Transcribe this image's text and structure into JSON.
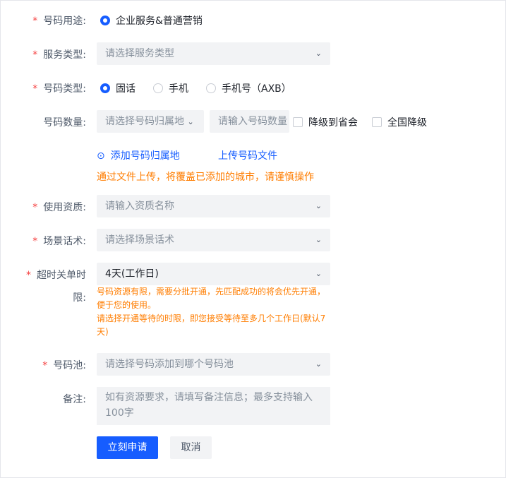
{
  "purpose": {
    "label": "号码用途:",
    "option": "企业服务&普通营销"
  },
  "service_type": {
    "label": "服务类型:",
    "placeholder": "请选择服务类型"
  },
  "number_type": {
    "label": "号码类型:",
    "options": [
      "固话",
      "手机",
      "手机号（AXB）"
    ],
    "selected": 0
  },
  "quantity": {
    "label": "号码数量:",
    "region_placeholder": "请选择号码归属地",
    "count_placeholder": "请输入号码数量",
    "downgrade_province": "降级到省会",
    "downgrade_national": "全国降级"
  },
  "add_region": "添加号码归属地",
  "upload_file": "上传号码文件",
  "upload_warning": "通过文件上传，将覆盖已添加的城市，请谨慎操作",
  "qualification": {
    "label": "使用资质:",
    "placeholder": "请输入资质名称"
  },
  "script": {
    "label": "场景话术:",
    "placeholder": "请选择场景话术"
  },
  "timeout": {
    "label_1": "超时关单时",
    "label_2": "限:",
    "value": "4天(工作日)",
    "hint_1": "号码资源有限，需要分批开通，先匹配成功的将会优先开通，便于您的使用。",
    "hint_2": "请选择开通等待的时限，即您接受等待至多几个工作日(默认7天)"
  },
  "pool": {
    "label": "号码池:",
    "placeholder": "请选择号码添加到哪个号码池"
  },
  "remark": {
    "label": "备注:",
    "placeholder": "如有资源要求，请填写备注信息；最多支持输入100字"
  },
  "submit": "立刻申请",
  "cancel": "取消"
}
